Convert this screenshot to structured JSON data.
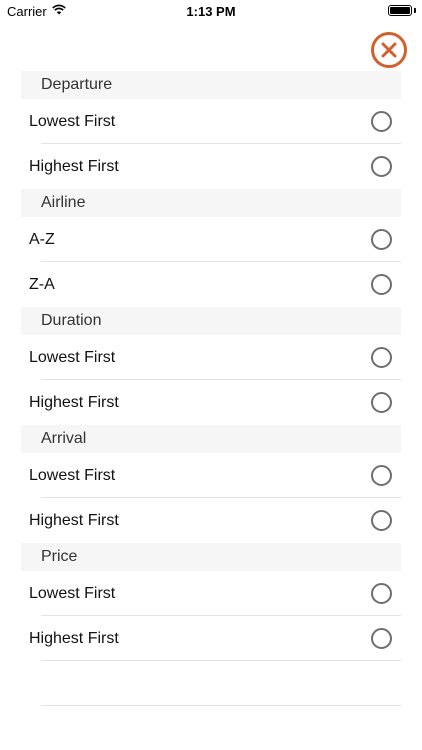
{
  "status_bar": {
    "carrier": "Carrier",
    "time": "1:13 PM",
    "wifi_icon": "wifi-icon",
    "battery_icon": "battery-icon"
  },
  "close_button": {
    "icon": "close-icon",
    "color": "#d2602e"
  },
  "sections": [
    {
      "title": "Departure",
      "options": [
        {
          "label": "Lowest First",
          "selected": false
        },
        {
          "label": "Highest First",
          "selected": false
        }
      ]
    },
    {
      "title": "Airline",
      "options": [
        {
          "label": "A-Z",
          "selected": false
        },
        {
          "label": "Z-A",
          "selected": false
        }
      ]
    },
    {
      "title": "Duration",
      "options": [
        {
          "label": "Lowest First",
          "selected": false
        },
        {
          "label": "Highest First",
          "selected": false
        }
      ]
    },
    {
      "title": "Arrival",
      "options": [
        {
          "label": "Lowest First",
          "selected": false
        },
        {
          "label": "Highest First",
          "selected": false
        }
      ]
    },
    {
      "title": "Price",
      "options": [
        {
          "label": "Lowest First",
          "selected": false
        },
        {
          "label": "Highest First",
          "selected": false
        }
      ]
    }
  ]
}
